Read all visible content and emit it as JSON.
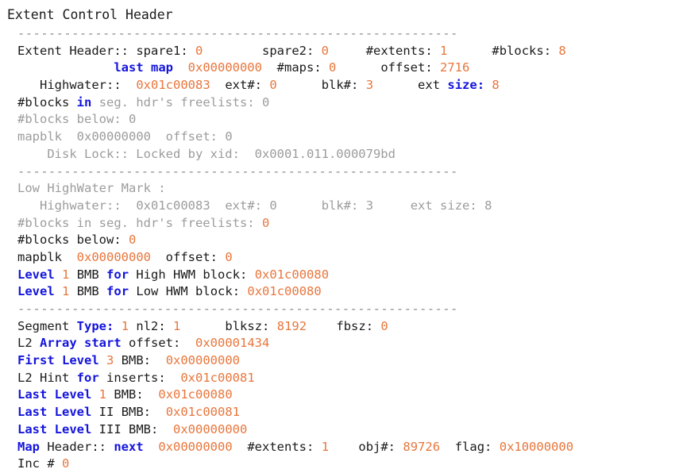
{
  "document": {
    "title": "Extent Control Header",
    "separator": "---------------------------------------------------------",
    "colors": {
      "text": "#1a1a1a",
      "dim": "#9c9c9c",
      "value": "#e8763c",
      "keyword": "#1414dc",
      "background": "#ffffff"
    }
  },
  "extent_header": {
    "label": "Extent Header::",
    "spare1_label": "spare1:",
    "spare1_value": "0",
    "spare2_label": "spare2:",
    "spare2_value": "0",
    "extents_label": "#extents:",
    "extents_value": "1",
    "blocks_label": "#blocks:",
    "blocks_value": "8",
    "last_map_label": "last map",
    "last_map_value": "0x00000000",
    "maps_label": "#maps:",
    "maps_value": "0",
    "offset_label": "offset:",
    "offset_value": "2716"
  },
  "high_highwater": {
    "highwater_label": "Highwater::",
    "highwater_value": "0x01c00083",
    "ext_label": "ext#:",
    "ext_value": "0",
    "blk_label": "blk#:",
    "blk_value": "3",
    "ext_size_prefix": "ext",
    "ext_size_label": "size:",
    "ext_size_value": "8",
    "freelists_prefix": "#blocks",
    "freelists_in": "in",
    "freelists_label": "seg. hdr's freelists:",
    "freelists_value": "0",
    "below_label": "#blocks below:",
    "below_value": "0",
    "mapblk_label": "mapblk",
    "mapblk_value": "0x00000000",
    "mapblk_offset_label": "offset:",
    "mapblk_offset_value": "0",
    "disk_lock_label": "Disk Lock:: Locked by xid:",
    "disk_lock_value": "0x0001.011.000079bd"
  },
  "low_highwater": {
    "heading": "Low HighWater Mark :",
    "highwater_label": "Highwater::",
    "highwater_value": "0x01c00083",
    "ext_label": "ext#:",
    "ext_value": "0",
    "blk_label": "blk#:",
    "blk_value": "3",
    "ext_size_label": "ext size:",
    "ext_size_value": "8",
    "freelists_label": "#blocks in seg. hdr's freelists:",
    "freelists_value": "0",
    "below_label": "#blocks below:",
    "below_value": "0",
    "mapblk_label": "mapblk",
    "mapblk_value": "0x00000000",
    "mapblk_offset_label": "offset:",
    "mapblk_offset_value": "0"
  },
  "bmb": {
    "high_level_kw": "Level",
    "high_level_num": "1",
    "high_mid": "BMB",
    "high_for": "for",
    "high_tail_label": "High HWM block:",
    "high_tail_value": "0x01c00080",
    "low_level_kw": "Level",
    "low_level_num": "1",
    "low_mid": "BMB",
    "low_for": "for",
    "low_tail_label": "Low HWM block:",
    "low_tail_value": "0x01c00080"
  },
  "segment": {
    "segment_prefix": "Segment",
    "type_label": "Type:",
    "type_value": "1",
    "nl2_label": "nl2:",
    "nl2_value": "1",
    "blksz_label": "blksz:",
    "blksz_value": "8192",
    "fbsz_label": "fbsz:",
    "fbsz_value": "0",
    "l2_prefix": "L2",
    "l2_array_start": "Array start",
    "l2_offset_label": "offset:",
    "l2_offset_value": "0x00001434",
    "first_level_kw": "First Level",
    "first_level_num": "3",
    "first_level_bmb": "BMB:",
    "first_level_value": "0x00000000",
    "l2_hint_prefix": "L2 Hint",
    "l2_hint_for": "for",
    "l2_hint_label": "inserts:",
    "l2_hint_value": "0x01c00081",
    "last_level_1_kw": "Last Level",
    "last_level_1_num": "1",
    "last_level_1_bmb": "BMB:",
    "last_level_1_value": "0x01c00080",
    "last_level_2_kw": "Last Level",
    "last_level_2_num": "II",
    "last_level_2_bmb": "BMB:",
    "last_level_2_value": "0x01c00081",
    "last_level_3_kw": "Last Level",
    "last_level_3_num": "III",
    "last_level_3_bmb": "BMB:",
    "last_level_3_value": "0x00000000"
  },
  "map_header": {
    "map_kw": "Map",
    "header_label": "Header::",
    "next_kw": "next",
    "next_value": "0x00000000",
    "extents_label": "#extents:",
    "extents_value": "1",
    "obj_label": "obj#:",
    "obj_value": "89726",
    "flag_label": "flag:",
    "flag_value": "0x10000000",
    "inc_label": "Inc #",
    "inc_value": "0"
  }
}
